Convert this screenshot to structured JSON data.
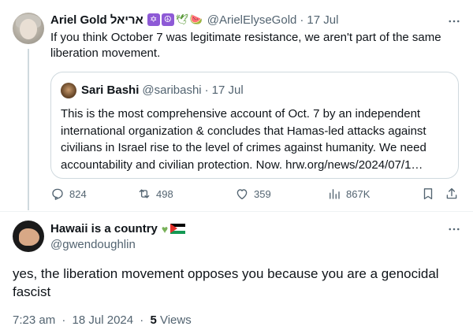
{
  "quoting_tweet": {
    "author_name": "Ariel Gold אריאל",
    "emojis": [
      "✡",
      "☮",
      "🕊",
      "🍉"
    ],
    "handle": "@ArielElyseGold",
    "separator": "·",
    "date": "17 Jul",
    "text": "If you think October 7 was legitimate resistance, we aren't part of the same liberation movement.",
    "quoted": {
      "author_name": "Sari Bashi",
      "handle": "@saribashi",
      "separator": "·",
      "date": "17 Jul",
      "text": "This is the most comprehensive account of Oct. 7 by an independent international organization & concludes that Hamas-led attacks against civilians in Israel rise to the level of crimes against humanity. We need accountability and civilian protection. Now. hrw.org/news/2024/07/1…"
    },
    "actions": {
      "replies": "824",
      "reposts": "498",
      "likes": "359",
      "views": "867K"
    }
  },
  "main_tweet": {
    "author_name": "Hawaii is a country",
    "handle": "@gwendoughlin",
    "text": "yes, the liberation movement opposes you because you are a genocidal fascist",
    "time": "7:23 am",
    "separator": "·",
    "date": "18 Jul 2024",
    "views_count": "5",
    "views_label": "Views"
  },
  "colors": {
    "text": "#0f1419",
    "muted": "#536471",
    "border": "#cfd9de",
    "divider": "#eff3f4"
  },
  "icons": [
    "more-icon",
    "reply-icon",
    "repost-icon",
    "like-icon",
    "views-icon",
    "bookmark-icon",
    "share-icon",
    "green-heart-icon",
    "palestine-flag-icon"
  ]
}
